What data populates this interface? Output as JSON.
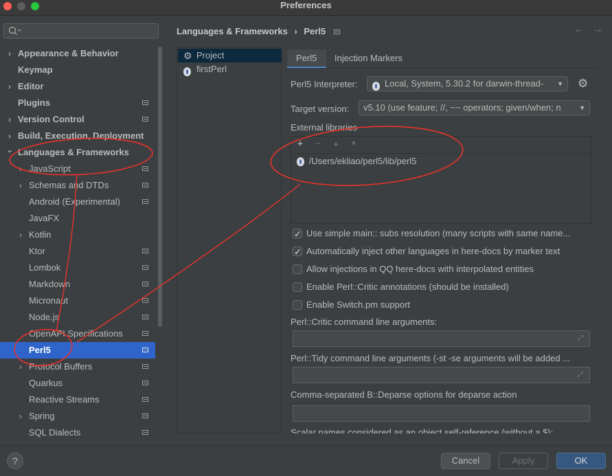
{
  "window": {
    "title": "Preferences"
  },
  "search": {
    "placeholder": "",
    "icon": "search-icon"
  },
  "sidebar": {
    "items": [
      {
        "label": "Appearance & Behavior",
        "level": 0,
        "bold": true,
        "expandable": true,
        "project": false
      },
      {
        "label": "Keymap",
        "level": 0,
        "bold": true,
        "expandable": false,
        "project": false
      },
      {
        "label": "Editor",
        "level": 0,
        "bold": true,
        "expandable": true,
        "project": false
      },
      {
        "label": "Plugins",
        "level": 0,
        "bold": true,
        "expandable": false,
        "project": true
      },
      {
        "label": "Version Control",
        "level": 0,
        "bold": true,
        "expandable": true,
        "project": true
      },
      {
        "label": "Build, Execution, Deployment",
        "level": 0,
        "bold": true,
        "expandable": true,
        "project": false
      },
      {
        "label": "Languages & Frameworks",
        "level": 0,
        "bold": true,
        "expandable": true,
        "expanded": true,
        "project": false
      },
      {
        "label": "JavaScript",
        "level": 1,
        "bold": false,
        "expandable": true,
        "project": true
      },
      {
        "label": "Schemas and DTDs",
        "level": 1,
        "bold": false,
        "expandable": true,
        "project": true
      },
      {
        "label": "Android (Experimental)",
        "level": 1,
        "bold": false,
        "expandable": false,
        "project": true
      },
      {
        "label": "JavaFX",
        "level": 1,
        "bold": false,
        "expandable": false,
        "project": false
      },
      {
        "label": "Kotlin",
        "level": 1,
        "bold": false,
        "expandable": true,
        "project": false
      },
      {
        "label": "Ktor",
        "level": 1,
        "bold": false,
        "expandable": false,
        "project": true
      },
      {
        "label": "Lombok",
        "level": 1,
        "bold": false,
        "expandable": false,
        "project": true
      },
      {
        "label": "Markdown",
        "level": 1,
        "bold": false,
        "expandable": false,
        "project": true
      },
      {
        "label": "Micronaut",
        "level": 1,
        "bold": false,
        "expandable": false,
        "project": true
      },
      {
        "label": "Node.js",
        "level": 1,
        "bold": false,
        "expandable": false,
        "project": true
      },
      {
        "label": "OpenAPI Specifications",
        "level": 1,
        "bold": false,
        "expandable": false,
        "project": true
      },
      {
        "label": "Perl5",
        "level": 1,
        "bold": true,
        "expandable": false,
        "project": true,
        "selected": true
      },
      {
        "label": "Protocol Buffers",
        "level": 1,
        "bold": false,
        "expandable": true,
        "project": true
      },
      {
        "label": "Quarkus",
        "level": 1,
        "bold": false,
        "expandable": false,
        "project": true
      },
      {
        "label": "Reactive Streams",
        "level": 1,
        "bold": false,
        "expandable": false,
        "project": true
      },
      {
        "label": "Spring",
        "level": 1,
        "bold": false,
        "expandable": true,
        "project": true
      },
      {
        "label": "SQL Dialects",
        "level": 1,
        "bold": false,
        "expandable": false,
        "project": true
      }
    ]
  },
  "header": {
    "breadcrumb_parent": "Languages & Frameworks",
    "breadcrumb_separator": "›",
    "breadcrumb_current": "Perl5",
    "back_icon": "arrow-left-icon",
    "forward_icon": "arrow-right-icon"
  },
  "project_panel": {
    "items": [
      {
        "label": "Project",
        "icon": "gear-icon",
        "selected": true
      },
      {
        "label": "firstPerl",
        "icon": "perl-onion-icon",
        "selected": false
      }
    ]
  },
  "tabs": [
    {
      "label": "Perl5",
      "active": true
    },
    {
      "label": "Injection Markers",
      "active": false
    }
  ],
  "settings": {
    "interpreter_label": "Perl5 Interpreter:",
    "interpreter_value": "Local, System, 5.30.2 for darwin-thread-",
    "target_label": "Target version:",
    "target_value": "v5.10 (use feature; //, ~~ operators; given/when; n",
    "external_libraries_label": "External libraries",
    "libraries_toolbar": {
      "add": "+",
      "remove": "−",
      "up": "▲",
      "down": "▼"
    },
    "libraries": [
      "/Users/ekliao/perl5/lib/perl5"
    ],
    "checkboxes": [
      {
        "label": "Use simple main:: subs resolution (many scripts with same name...",
        "checked": true
      },
      {
        "label": "Automatically inject other languages in here-docs by marker text",
        "checked": true
      },
      {
        "label": "Allow injections in QQ here-docs with interpolated entities",
        "checked": false
      },
      {
        "label": "Enable Perl::Critic annotations (should be installed)",
        "checked": false
      },
      {
        "label": "Enable Switch.pm support",
        "checked": false
      }
    ],
    "critic_args_label": "Perl::Critic command line arguments:",
    "critic_args_value": "",
    "tidy_args_label": "Perl::Tidy command line arguments (-st -se arguments will be added ...",
    "tidy_args_value": "",
    "deparse_label": "Comma-separated B::Deparse options for deparse action",
    "deparse_value": "",
    "scalar_names_label": "Scalar names considered as an object self-reference (without a $):"
  },
  "buttons": {
    "help": "?",
    "cancel": "Cancel",
    "apply": "Apply",
    "ok": "OK"
  },
  "colors": {
    "background": "#3c3f41",
    "selection": "#2f65ca",
    "ok_button": "#365880",
    "annotation": "#e8322c"
  }
}
